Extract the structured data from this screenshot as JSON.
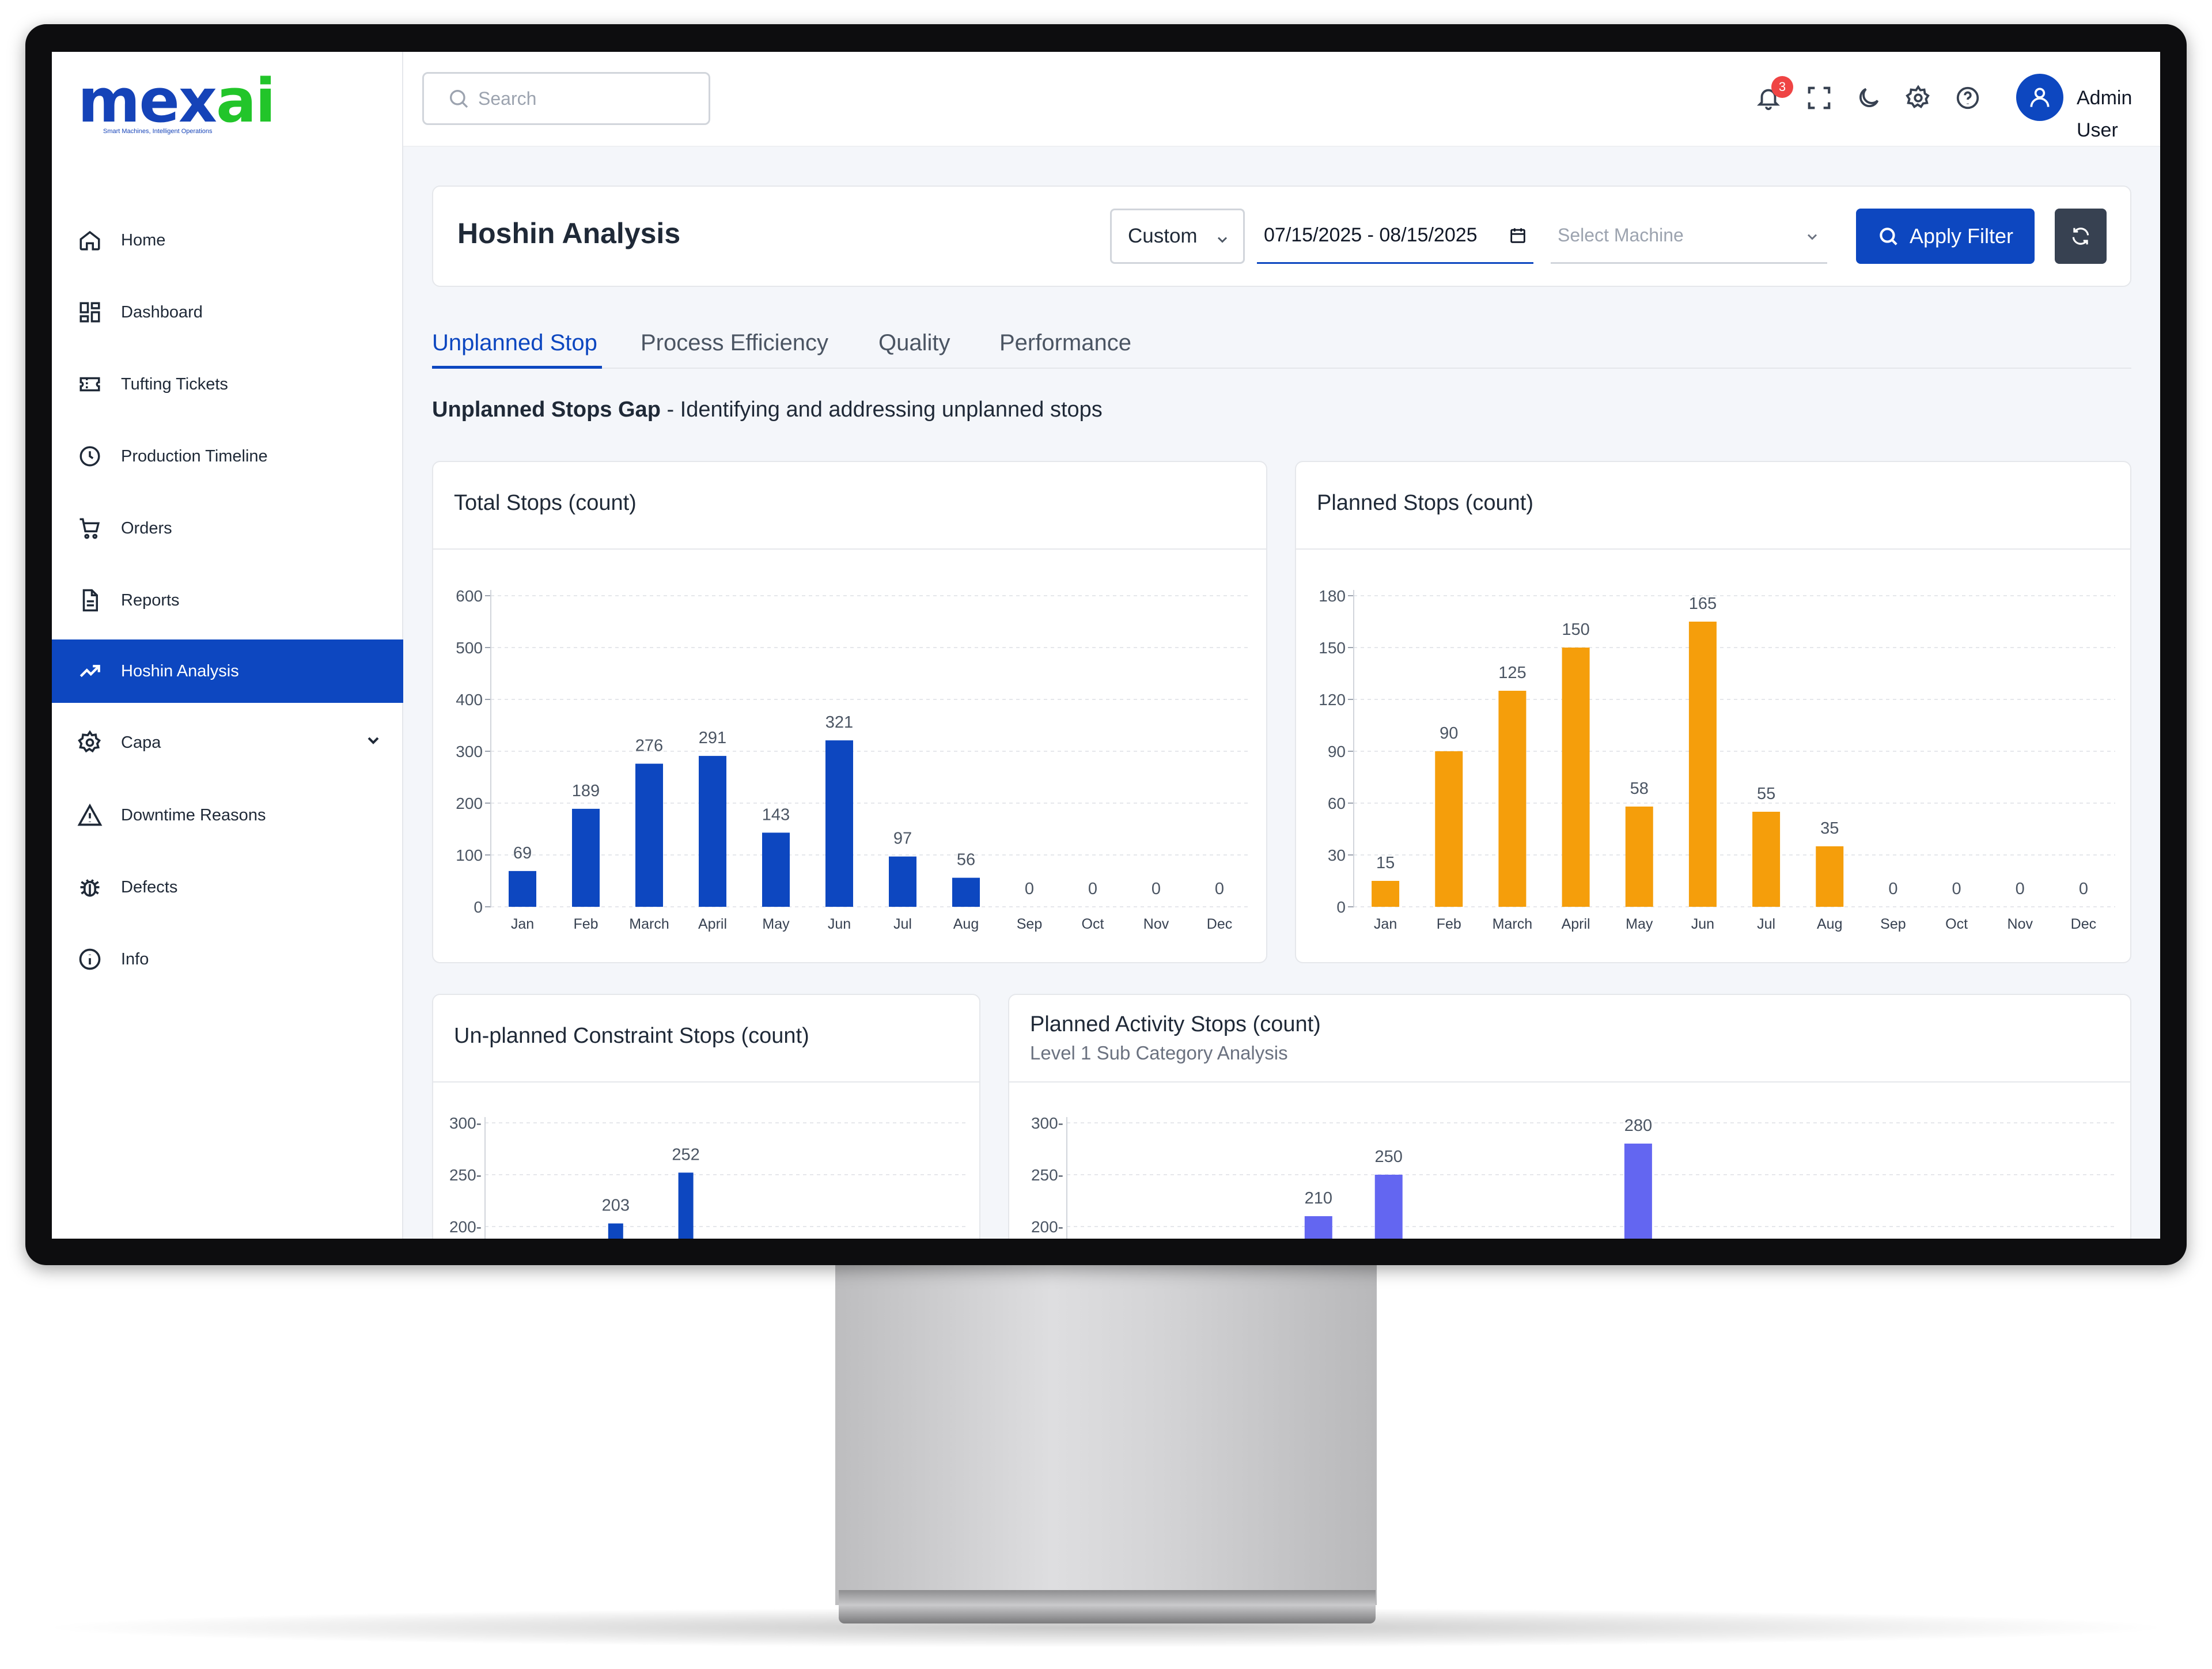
{
  "app": {
    "logo_text_blue": "mex",
    "logo_text_green": "ai",
    "logo_tagline": "Smart Machines, Intelligent Operations"
  },
  "sidebar": {
    "items": [
      {
        "label": "Home",
        "icon": "home-icon"
      },
      {
        "label": "Dashboard",
        "icon": "dashboard-icon"
      },
      {
        "label": "Tufting Tickets",
        "icon": "ticket-icon"
      },
      {
        "label": "Production Timeline",
        "icon": "clock-icon"
      },
      {
        "label": "Orders",
        "icon": "cart-icon"
      },
      {
        "label": "Reports",
        "icon": "document-icon"
      },
      {
        "label": "Hoshin Analysis",
        "icon": "trending-up-icon",
        "active": true
      },
      {
        "label": "Capa",
        "icon": "gear-icon",
        "expandable": true
      },
      {
        "label": "Downtime Reasons",
        "icon": "warning-icon"
      },
      {
        "label": "Defects",
        "icon": "bug-icon"
      },
      {
        "label": "Info",
        "icon": "info-icon"
      }
    ]
  },
  "header": {
    "search_placeholder": "Search",
    "notification_count": "3",
    "user_name": "Admin User"
  },
  "filter": {
    "title": "Hoshin Analysis",
    "period": "Custom",
    "date_range": "07/15/2025 - 08/15/2025",
    "machine_placeholder": "Select Machine",
    "apply_label": "Apply Filter"
  },
  "tabs": [
    {
      "label": "Unplanned Stop",
      "active": true
    },
    {
      "label": "Process Efficiency"
    },
    {
      "label": "Quality"
    },
    {
      "label": "Performance"
    }
  ],
  "section": {
    "title": "Unplanned Stops Gap",
    "subtitle": " - Identifying and addressing unplanned stops"
  },
  "colors": {
    "primary": "#0d47c0",
    "orange": "#f59e0b",
    "purple": "#6366f1"
  },
  "chart_data": [
    {
      "type": "bar",
      "title": "Total Stops (count)",
      "categories": [
        "Jan",
        "Feb",
        "March",
        "April",
        "May",
        "Jun",
        "Jul",
        "Aug",
        "Sep",
        "Oct",
        "Nov",
        "Dec"
      ],
      "values": [
        69,
        189,
        276,
        291,
        143,
        321,
        97,
        56,
        0,
        0,
        0,
        0
      ],
      "ylim": [
        0,
        600
      ],
      "yticks": [
        0,
        100,
        200,
        300,
        400,
        500,
        600
      ],
      "color": "#0d47c0"
    },
    {
      "type": "bar",
      "title": "Planned Stops (count)",
      "categories": [
        "Jan",
        "Feb",
        "March",
        "April",
        "May",
        "Jun",
        "Jul",
        "Aug",
        "Sep",
        "Oct",
        "Nov",
        "Dec"
      ],
      "values": [
        15,
        90,
        125,
        150,
        58,
        165,
        55,
        35,
        0,
        0,
        0,
        0
      ],
      "ylim": [
        0,
        180
      ],
      "yticks": [
        0,
        30,
        60,
        90,
        120,
        150,
        180
      ],
      "color": "#f59e0b"
    },
    {
      "type": "bar",
      "title": "Un-planned Constraint Stops (count)",
      "visible_values": [
        203,
        252
      ],
      "yticks_visible": [
        200,
        250,
        300
      ],
      "color": "#0d47c0"
    },
    {
      "type": "bar",
      "title": "Planned Activity Stops (count)",
      "subtitle": "Level 1 Sub Category Analysis",
      "visible_values": [
        210,
        250,
        280
      ],
      "yticks_visible": [
        200,
        250,
        300
      ],
      "color": "#6366f1"
    }
  ]
}
